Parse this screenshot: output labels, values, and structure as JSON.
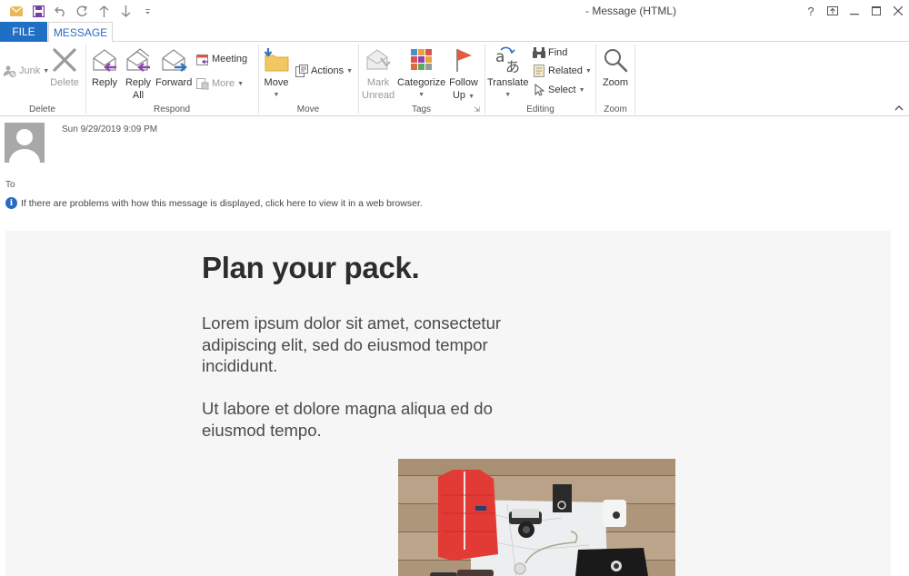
{
  "window": {
    "title": "- Message (HTML)",
    "controls": [
      "help",
      "ribbon-display-options",
      "minimize",
      "maximize",
      "close"
    ]
  },
  "quick_access": {
    "icons": [
      "mail-icon",
      "save-icon",
      "undo-icon",
      "redo-icon",
      "up-arrow-icon",
      "down-arrow-icon",
      "customize-icon"
    ]
  },
  "tabs": {
    "file": "FILE",
    "message": "MESSAGE"
  },
  "ribbon": {
    "delete_group": {
      "label": "Delete",
      "junk": "Junk",
      "delete": "Delete"
    },
    "respond_group": {
      "label": "Respond",
      "reply": "Reply",
      "reply_all_1": "Reply",
      "reply_all_2": "All",
      "forward": "Forward",
      "meeting": "Meeting",
      "more": "More"
    },
    "move_group": {
      "label": "Move",
      "move": "Move",
      "actions": "Actions"
    },
    "tags_group": {
      "label": "Tags",
      "mark_unread_1": "Mark",
      "mark_unread_2": "Unread",
      "categorize": "Categorize",
      "follow_up_1": "Follow",
      "follow_up_2": "Up"
    },
    "editing_group": {
      "label": "Editing",
      "translate": "Translate",
      "find": "Find",
      "related": "Related",
      "select": "Select"
    },
    "zoom_group": {
      "label": "Zoom",
      "zoom": "Zoom"
    }
  },
  "message_header": {
    "date": "Sun 9/29/2019 9:09 PM",
    "to_label": "To",
    "info_text": "If there are problems with how this message is displayed, click here to view it in a web browser."
  },
  "message_body": {
    "headline": "Plan your pack.",
    "paragraph1": "Lorem ipsum dolor sit amet, consectetur adipiscing elit, sed do eiusmod tempor incididunt.",
    "paragraph2": "Ut labore et dolore magna aliqua ed do eiusmod tempo.",
    "image_alt": "Travel gear flat lay: red jacket, map, camera, notebook, instant camera, black bag on wooden boards"
  },
  "colors": {
    "file_tab": "#1f6fc4",
    "message_tab_text": "#2b6bbf",
    "body_background": "#f6f6f6",
    "headline": "#2d2d2d"
  }
}
